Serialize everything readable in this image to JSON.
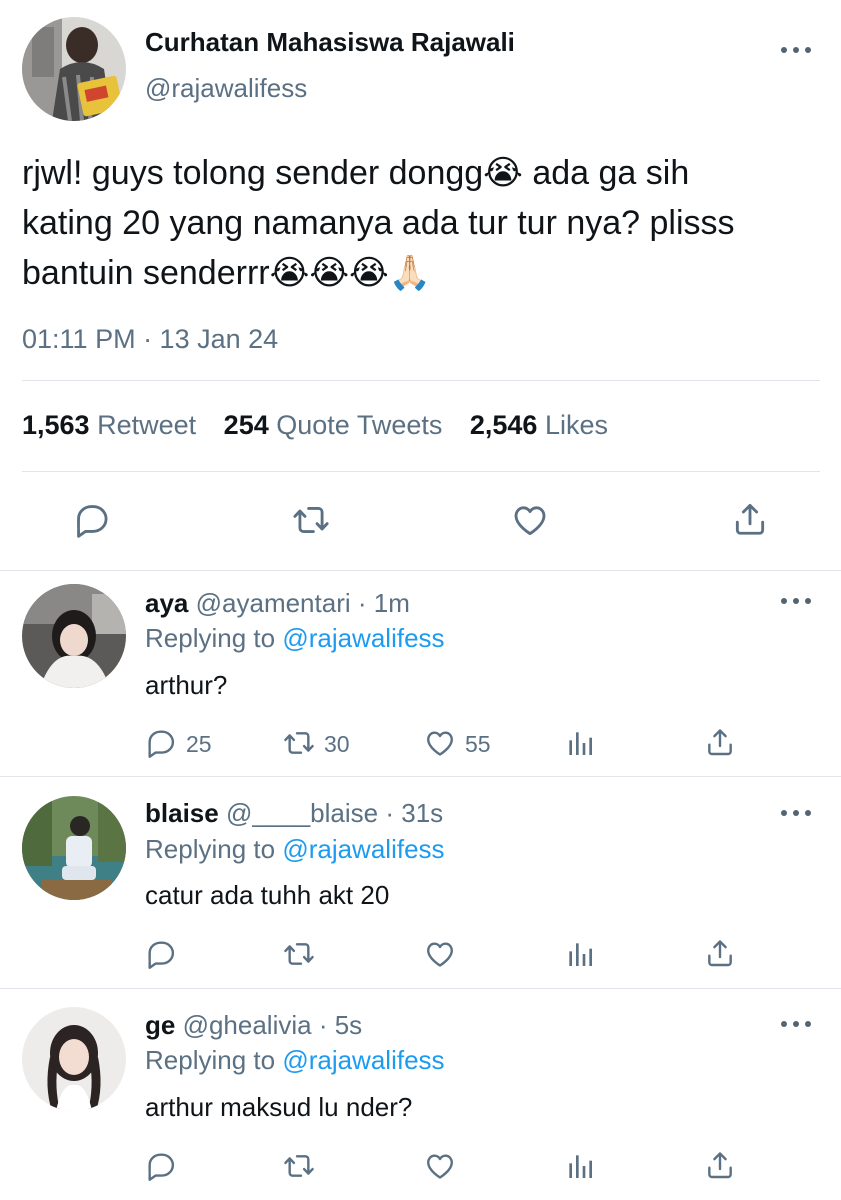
{
  "tweet": {
    "author_name": "Curhatan Mahasiswa Rajawali",
    "author_handle": "@rajawalifess",
    "text_line1": "rjwl! guys tolong sender dongg😭  ada ga sih",
    "text_line2": "kating 20 yang namanya ada tur tur nya? plisss",
    "text_line3": "bantuin senderrr😭😭😭🙏🏻",
    "timestamp": "01:11 PM · 13 Jan 24",
    "retweets_count": "1,563",
    "retweets_label": "Retweet",
    "quotes_count": "254",
    "quotes_label": "Quote Tweets",
    "likes_count": "2,546",
    "likes_label": "Likes"
  },
  "replies": [
    {
      "name": "aya",
      "handle": "@ayamentari",
      "time": "· 1m",
      "replying_prefix": "Replying to",
      "replying_to": "@rajawalifess",
      "text": "arthur?",
      "reply_count": "25",
      "retweet_count": "30",
      "like_count": "55"
    },
    {
      "name": "blaise",
      "handle": "@____blaise",
      "time": "· 31s",
      "replying_prefix": "Replying to",
      "replying_to": "@rajawalifess",
      "text": "catur ada tuhh akt 20",
      "reply_count": "",
      "retweet_count": "",
      "like_count": ""
    },
    {
      "name": "ge",
      "handle": "@ghealivia",
      "time": "· 5s",
      "replying_prefix": "Replying to",
      "replying_to": "@rajawalifess",
      "text": "arthur maksud lu nder?",
      "reply_count": "",
      "retweet_count": "",
      "like_count": ""
    }
  ],
  "colors": {
    "accent": "#1d9bf0",
    "muted": "#5b7083",
    "icon": "#5b7083",
    "divider": "#e1e4e8"
  },
  "icons": [
    "reply-icon",
    "retweet-icon",
    "like-icon",
    "share-icon",
    "analytics-icon",
    "more-icon"
  ]
}
